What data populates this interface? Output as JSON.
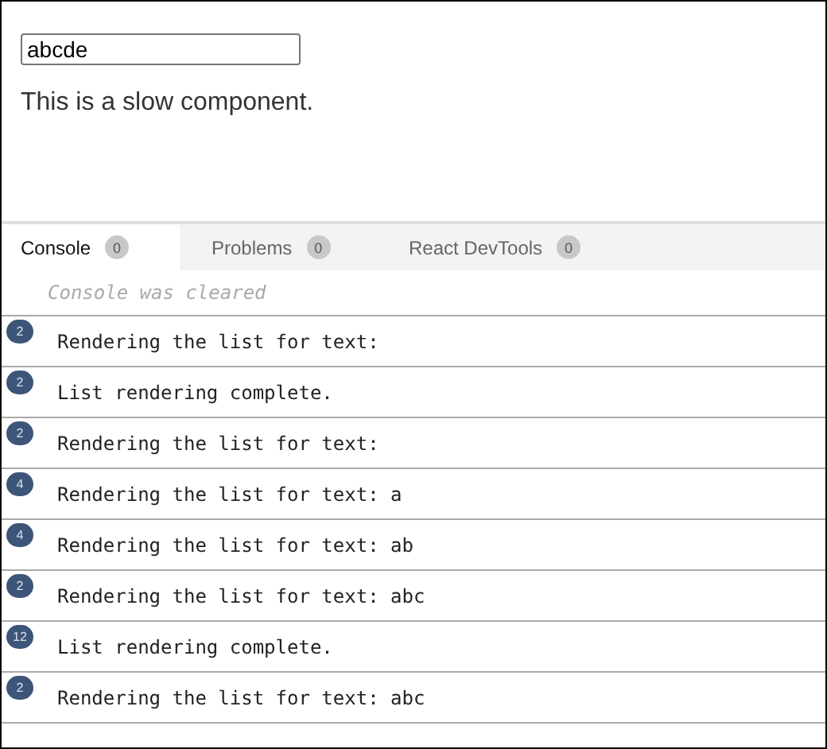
{
  "preview": {
    "input": {
      "value": "abcde"
    },
    "text": "This is a slow component."
  },
  "tabs": [
    {
      "label": "Console",
      "count": "0",
      "selected": true
    },
    {
      "label": "Problems",
      "count": "0",
      "selected": false
    },
    {
      "label": "React DevTools",
      "count": "0",
      "selected": false
    }
  ],
  "console": {
    "notice": "Console was cleared",
    "entries": [
      {
        "count": "2",
        "message": "Rendering the list for text:"
      },
      {
        "count": "2",
        "message": "List rendering complete."
      },
      {
        "count": "2",
        "message": "Rendering the list for text:"
      },
      {
        "count": "4",
        "message": "Rendering the list for text: a"
      },
      {
        "count": "4",
        "message": "Rendering the list for text: ab"
      },
      {
        "count": "2",
        "message": "Rendering the list for text: abc"
      },
      {
        "count": "12",
        "message": "List rendering complete."
      },
      {
        "count": "2",
        "message": "Rendering the list for text: abc"
      }
    ]
  }
}
